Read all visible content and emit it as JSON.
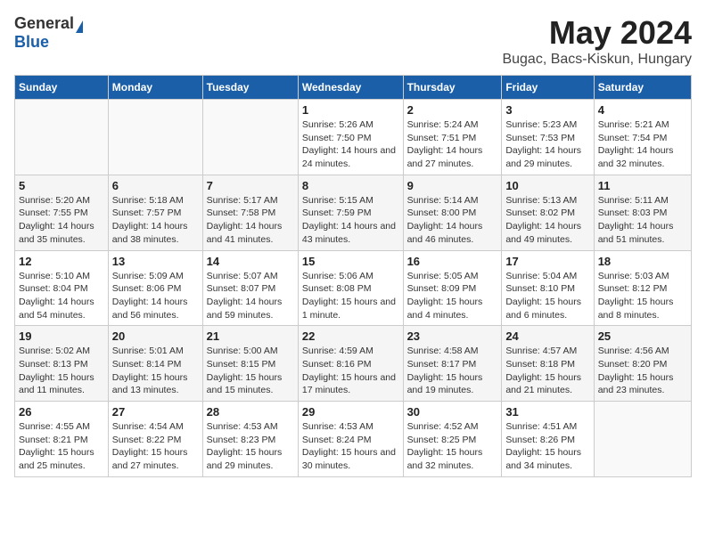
{
  "logo": {
    "general": "General",
    "blue": "Blue"
  },
  "title": "May 2024",
  "subtitle": "Bugac, Bacs-Kiskun, Hungary",
  "days": [
    "Sunday",
    "Monday",
    "Tuesday",
    "Wednesday",
    "Thursday",
    "Friday",
    "Saturday"
  ],
  "weeks": [
    [
      {
        "date": "",
        "sunrise": "",
        "sunset": "",
        "daylight": ""
      },
      {
        "date": "",
        "sunrise": "",
        "sunset": "",
        "daylight": ""
      },
      {
        "date": "",
        "sunrise": "",
        "sunset": "",
        "daylight": ""
      },
      {
        "date": "1",
        "sunrise": "Sunrise: 5:26 AM",
        "sunset": "Sunset: 7:50 PM",
        "daylight": "Daylight: 14 hours and 24 minutes."
      },
      {
        "date": "2",
        "sunrise": "Sunrise: 5:24 AM",
        "sunset": "Sunset: 7:51 PM",
        "daylight": "Daylight: 14 hours and 27 minutes."
      },
      {
        "date": "3",
        "sunrise": "Sunrise: 5:23 AM",
        "sunset": "Sunset: 7:53 PM",
        "daylight": "Daylight: 14 hours and 29 minutes."
      },
      {
        "date": "4",
        "sunrise": "Sunrise: 5:21 AM",
        "sunset": "Sunset: 7:54 PM",
        "daylight": "Daylight: 14 hours and 32 minutes."
      }
    ],
    [
      {
        "date": "5",
        "sunrise": "Sunrise: 5:20 AM",
        "sunset": "Sunset: 7:55 PM",
        "daylight": "Daylight: 14 hours and 35 minutes."
      },
      {
        "date": "6",
        "sunrise": "Sunrise: 5:18 AM",
        "sunset": "Sunset: 7:57 PM",
        "daylight": "Daylight: 14 hours and 38 minutes."
      },
      {
        "date": "7",
        "sunrise": "Sunrise: 5:17 AM",
        "sunset": "Sunset: 7:58 PM",
        "daylight": "Daylight: 14 hours and 41 minutes."
      },
      {
        "date": "8",
        "sunrise": "Sunrise: 5:15 AM",
        "sunset": "Sunset: 7:59 PM",
        "daylight": "Daylight: 14 hours and 43 minutes."
      },
      {
        "date": "9",
        "sunrise": "Sunrise: 5:14 AM",
        "sunset": "Sunset: 8:00 PM",
        "daylight": "Daylight: 14 hours and 46 minutes."
      },
      {
        "date": "10",
        "sunrise": "Sunrise: 5:13 AM",
        "sunset": "Sunset: 8:02 PM",
        "daylight": "Daylight: 14 hours and 49 minutes."
      },
      {
        "date": "11",
        "sunrise": "Sunrise: 5:11 AM",
        "sunset": "Sunset: 8:03 PM",
        "daylight": "Daylight: 14 hours and 51 minutes."
      }
    ],
    [
      {
        "date": "12",
        "sunrise": "Sunrise: 5:10 AM",
        "sunset": "Sunset: 8:04 PM",
        "daylight": "Daylight: 14 hours and 54 minutes."
      },
      {
        "date": "13",
        "sunrise": "Sunrise: 5:09 AM",
        "sunset": "Sunset: 8:06 PM",
        "daylight": "Daylight: 14 hours and 56 minutes."
      },
      {
        "date": "14",
        "sunrise": "Sunrise: 5:07 AM",
        "sunset": "Sunset: 8:07 PM",
        "daylight": "Daylight: 14 hours and 59 minutes."
      },
      {
        "date": "15",
        "sunrise": "Sunrise: 5:06 AM",
        "sunset": "Sunset: 8:08 PM",
        "daylight": "Daylight: 15 hours and 1 minute."
      },
      {
        "date": "16",
        "sunrise": "Sunrise: 5:05 AM",
        "sunset": "Sunset: 8:09 PM",
        "daylight": "Daylight: 15 hours and 4 minutes."
      },
      {
        "date": "17",
        "sunrise": "Sunrise: 5:04 AM",
        "sunset": "Sunset: 8:10 PM",
        "daylight": "Daylight: 15 hours and 6 minutes."
      },
      {
        "date": "18",
        "sunrise": "Sunrise: 5:03 AM",
        "sunset": "Sunset: 8:12 PM",
        "daylight": "Daylight: 15 hours and 8 minutes."
      }
    ],
    [
      {
        "date": "19",
        "sunrise": "Sunrise: 5:02 AM",
        "sunset": "Sunset: 8:13 PM",
        "daylight": "Daylight: 15 hours and 11 minutes."
      },
      {
        "date": "20",
        "sunrise": "Sunrise: 5:01 AM",
        "sunset": "Sunset: 8:14 PM",
        "daylight": "Daylight: 15 hours and 13 minutes."
      },
      {
        "date": "21",
        "sunrise": "Sunrise: 5:00 AM",
        "sunset": "Sunset: 8:15 PM",
        "daylight": "Daylight: 15 hours and 15 minutes."
      },
      {
        "date": "22",
        "sunrise": "Sunrise: 4:59 AM",
        "sunset": "Sunset: 8:16 PM",
        "daylight": "Daylight: 15 hours and 17 minutes."
      },
      {
        "date": "23",
        "sunrise": "Sunrise: 4:58 AM",
        "sunset": "Sunset: 8:17 PM",
        "daylight": "Daylight: 15 hours and 19 minutes."
      },
      {
        "date": "24",
        "sunrise": "Sunrise: 4:57 AM",
        "sunset": "Sunset: 8:18 PM",
        "daylight": "Daylight: 15 hours and 21 minutes."
      },
      {
        "date": "25",
        "sunrise": "Sunrise: 4:56 AM",
        "sunset": "Sunset: 8:20 PM",
        "daylight": "Daylight: 15 hours and 23 minutes."
      }
    ],
    [
      {
        "date": "26",
        "sunrise": "Sunrise: 4:55 AM",
        "sunset": "Sunset: 8:21 PM",
        "daylight": "Daylight: 15 hours and 25 minutes."
      },
      {
        "date": "27",
        "sunrise": "Sunrise: 4:54 AM",
        "sunset": "Sunset: 8:22 PM",
        "daylight": "Daylight: 15 hours and 27 minutes."
      },
      {
        "date": "28",
        "sunrise": "Sunrise: 4:53 AM",
        "sunset": "Sunset: 8:23 PM",
        "daylight": "Daylight: 15 hours and 29 minutes."
      },
      {
        "date": "29",
        "sunrise": "Sunrise: 4:53 AM",
        "sunset": "Sunset: 8:24 PM",
        "daylight": "Daylight: 15 hours and 30 minutes."
      },
      {
        "date": "30",
        "sunrise": "Sunrise: 4:52 AM",
        "sunset": "Sunset: 8:25 PM",
        "daylight": "Daylight: 15 hours and 32 minutes."
      },
      {
        "date": "31",
        "sunrise": "Sunrise: 4:51 AM",
        "sunset": "Sunset: 8:26 PM",
        "daylight": "Daylight: 15 hours and 34 minutes."
      },
      {
        "date": "",
        "sunrise": "",
        "sunset": "",
        "daylight": ""
      }
    ]
  ]
}
